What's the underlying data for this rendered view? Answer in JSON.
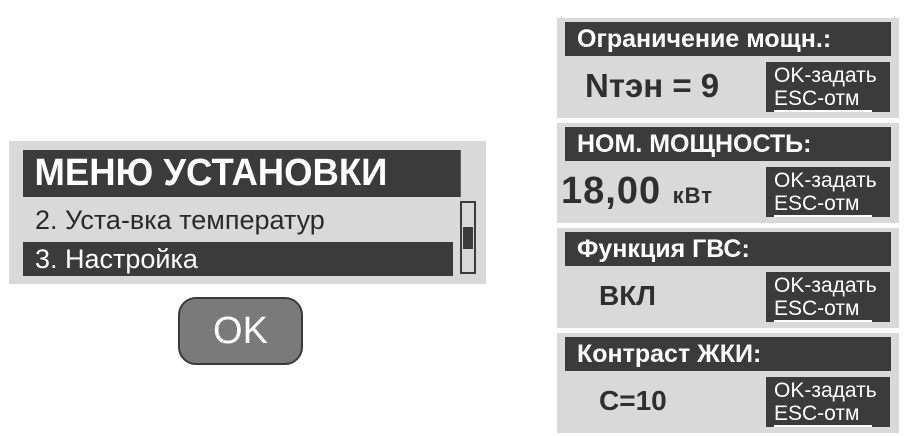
{
  "menu": {
    "title": "МЕНЮ УСТАНОВКИ",
    "items": [
      {
        "label": "2. Уста-вка температур"
      },
      {
        "label": "3. Настройка"
      }
    ]
  },
  "ok_button": {
    "label": "OK"
  },
  "panels": [
    {
      "title": "Ограничение мощн.:",
      "value": "Nтэн = 9",
      "unit": "",
      "hint_ok": "OK-задать",
      "hint_esc": "ESC-отм"
    },
    {
      "title": "НОМ. МОЩНОСТЬ:",
      "value": "18,00",
      "unit": "кВт",
      "hint_ok": "OK-задать",
      "hint_esc": "ESC-отм"
    },
    {
      "title": "Функция ГВС:",
      "value": "ВКЛ",
      "unit": "",
      "hint_ok": "OK-задать",
      "hint_esc": "ESC-отм"
    },
    {
      "title": "Контраст ЖКИ:",
      "value": "С=10",
      "unit": "",
      "hint_ok": "OK-задать",
      "hint_esc": "ESC-отм"
    }
  ]
}
